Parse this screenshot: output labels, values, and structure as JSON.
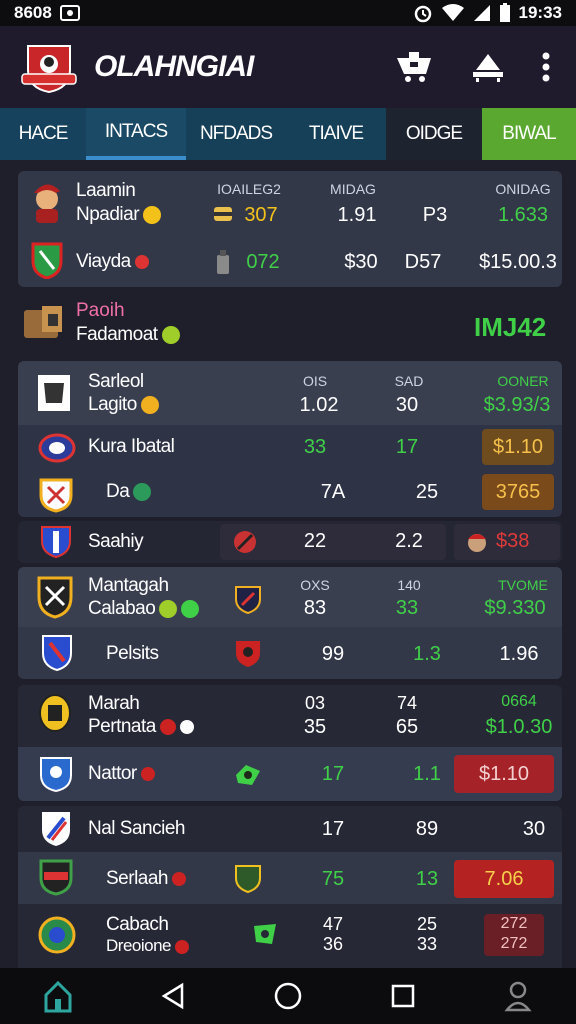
{
  "status": {
    "time_left": "8608",
    "time_right": "19:33"
  },
  "app": {
    "title": "OLAHNGIAI"
  },
  "tabs": [
    "HACE",
    "INTACS",
    "NFDADS",
    "TIAIVE",
    "OIDGE",
    "BIWAL"
  ],
  "colors": {
    "accent_green": "#3fd048",
    "accent_yellow": "#f3c21a",
    "tab_bg": "#16405a",
    "highlight_tab": "#5aa830",
    "card_bg": "#333849"
  },
  "top_card": {
    "headers": [
      "IOAILEG2",
      "MIDAG",
      "ONIDAG"
    ],
    "rows": [
      {
        "name1": "Laamin",
        "name2": "Npadiar",
        "v1": "307",
        "v2": "1.91",
        "v3": "P3",
        "v4": "1.633"
      },
      {
        "name": "Viayda",
        "v1": "072",
        "v2": "$30",
        "v3": "D57",
        "v4": "$15.00.3"
      }
    ]
  },
  "section": {
    "line1": "Paoih",
    "line2": "Fadamoat",
    "score": "IMJ42"
  },
  "group1": {
    "headers": [
      "OIS",
      "SAD",
      "OONER"
    ],
    "rows": [
      {
        "name1": "Sarleol",
        "name2": "Lagito",
        "v1": "1.02",
        "v2": "30",
        "v3": "$3.93/3"
      },
      {
        "name": "Kura Ibatal",
        "v1": "33",
        "v2": "17",
        "v3": "$1.10"
      },
      {
        "name": "Da",
        "v1": "7A",
        "v2": "25",
        "v3": "3765"
      }
    ]
  },
  "bar_row": {
    "name": "Saahiy",
    "v1": "22",
    "v2": "2.2",
    "v3": "$38"
  },
  "group2": {
    "headers": [
      "OXS",
      "140",
      "TVOME"
    ],
    "rows": [
      {
        "name1": "Mantagah",
        "name2": "Calabao",
        "v1": "83",
        "v2": "33",
        "v3": "$9.330"
      },
      {
        "name": "Pelsits",
        "v1": "99",
        "v2": "1.3",
        "v3": "1.96"
      }
    ]
  },
  "group3": {
    "rows": [
      {
        "name1": "Marah",
        "name2": "Pertnata",
        "h1": "03",
        "h2": "74",
        "h3": "0664",
        "v1": "35",
        "v2": "65",
        "v3": "$1.0.30"
      },
      {
        "name": "Nattor",
        "v1": "17",
        "v2": "1.1",
        "v3": "$1.10"
      }
    ]
  },
  "group4": {
    "rows": [
      {
        "name": "Nal Sancieh",
        "v1": "17",
        "v2": "89",
        "v3": "30"
      },
      {
        "name": "Serlaah",
        "v1": "75",
        "v2": "13",
        "v3": "7.06"
      },
      {
        "name1": "Cabach",
        "name2": "Dreoione",
        "a1": "47",
        "a2": "36",
        "b1": "25",
        "b2": "33",
        "c1": "272",
        "c2": "272"
      }
    ]
  },
  "nav": [
    "home-icon",
    "back-icon",
    "circle-home-icon",
    "recents-icon",
    "profile-icon"
  ]
}
